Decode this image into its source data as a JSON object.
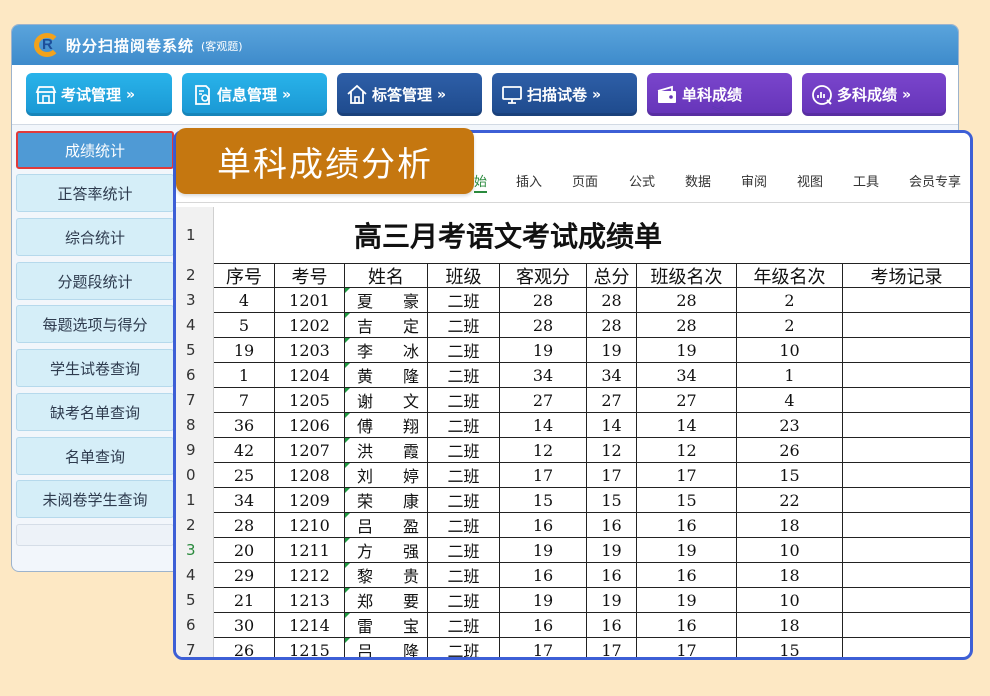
{
  "app": {
    "title": "盼分扫描阅卷系统",
    "subtitle": "(客观题)",
    "logo_letter": "R"
  },
  "nav": [
    {
      "label": "考试管理",
      "icon": "shop-icon"
    },
    {
      "label": "信息管理",
      "icon": "document-settings-icon"
    },
    {
      "label": "标答管理",
      "icon": "home-icon"
    },
    {
      "label": "扫描试卷",
      "icon": "monitor-icon"
    },
    {
      "label": "单科成绩",
      "icon": "wallet-icon"
    },
    {
      "label": "多科成绩",
      "icon": "analysis-icon"
    }
  ],
  "sidebar": [
    {
      "label": "成绩统计"
    },
    {
      "label": "正答率统计"
    },
    {
      "label": "综合统计"
    },
    {
      "label": "分题段统计"
    },
    {
      "label": "每题选项与得分"
    },
    {
      "label": "学生试卷查询"
    },
    {
      "label": "缺考名单查询"
    },
    {
      "label": "名单查询"
    },
    {
      "label": "未阅卷学生查询"
    }
  ],
  "badge": "单科成绩分析",
  "ribbon_tabs": [
    "始",
    "插入",
    "页面",
    "公式",
    "数据",
    "审阅",
    "视图",
    "工具",
    "会员专享"
  ],
  "sheet": {
    "title": "高三月考语文考试成绩单",
    "row_numbers": [
      "1",
      "2",
      "3",
      "4",
      "5",
      "6",
      "7",
      "8",
      "9",
      "0",
      "1",
      "2",
      "3",
      "4",
      "5",
      "6",
      "7"
    ],
    "headers": [
      "序号",
      "考号",
      "姓名",
      "班级",
      "客观分",
      "总分",
      "班级名次",
      "年级名次",
      "考场记录"
    ],
    "rows": [
      [
        "4",
        "1201",
        "夏",
        "豪",
        "二班",
        "28",
        "28",
        "28",
        "2"
      ],
      [
        "5",
        "1202",
        "吉",
        "定",
        "二班",
        "28",
        "28",
        "28",
        "2"
      ],
      [
        "19",
        "1203",
        "李",
        "冰",
        "二班",
        "19",
        "19",
        "19",
        "10"
      ],
      [
        "1",
        "1204",
        "黄",
        "隆",
        "二班",
        "34",
        "34",
        "34",
        "1"
      ],
      [
        "7",
        "1205",
        "谢",
        "文",
        "二班",
        "27",
        "27",
        "27",
        "4"
      ],
      [
        "36",
        "1206",
        "傅",
        "翔",
        "二班",
        "14",
        "14",
        "14",
        "23"
      ],
      [
        "42",
        "1207",
        "洪",
        "霞",
        "二班",
        "12",
        "12",
        "12",
        "26"
      ],
      [
        "25",
        "1208",
        "刘",
        "婷",
        "二班",
        "17",
        "17",
        "17",
        "15"
      ],
      [
        "34",
        "1209",
        "荣",
        "康",
        "二班",
        "15",
        "15",
        "15",
        "22"
      ],
      [
        "28",
        "1210",
        "吕",
        "盈",
        "二班",
        "16",
        "16",
        "16",
        "18"
      ],
      [
        "20",
        "1211",
        "方",
        "强",
        "二班",
        "19",
        "19",
        "19",
        "10"
      ],
      [
        "29",
        "1212",
        "黎",
        "贵",
        "二班",
        "16",
        "16",
        "16",
        "18"
      ],
      [
        "21",
        "1213",
        "郑",
        "要",
        "二班",
        "19",
        "19",
        "19",
        "10"
      ],
      [
        "30",
        "1214",
        "雷",
        "宝",
        "二班",
        "16",
        "16",
        "16",
        "18"
      ],
      [
        "26",
        "1215",
        "吕",
        "隆",
        "二班",
        "17",
        "17",
        "17",
        "15"
      ]
    ]
  }
}
